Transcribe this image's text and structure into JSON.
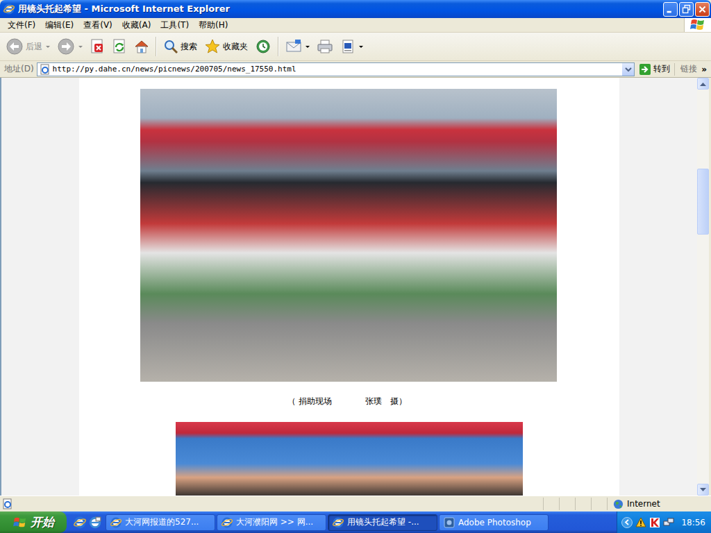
{
  "window": {
    "title": "用镜头托起希望 - Microsoft Internet Explorer"
  },
  "menu": [
    "文件(F)",
    "编辑(E)",
    "查看(V)",
    "收藏(A)",
    "工具(T)",
    "帮助(H)"
  ],
  "toolbar": [
    {
      "kind": "back",
      "label": "后退",
      "dropdown": true,
      "disabled": true
    },
    {
      "kind": "forward",
      "dropdown": true,
      "disabled": true
    },
    {
      "kind": "stop",
      "dropdown": false,
      "disabled": false
    },
    {
      "kind": "refresh",
      "dropdown": false,
      "disabled": false
    },
    {
      "kind": "home",
      "dropdown": false,
      "disabled": false
    },
    {
      "kind": "separator"
    },
    {
      "kind": "search",
      "label": "搜索",
      "dropdown": false,
      "disabled": false
    },
    {
      "kind": "favorites",
      "label": "收藏夹",
      "dropdown": false,
      "disabled": false
    },
    {
      "kind": "history",
      "dropdown": false,
      "disabled": false
    },
    {
      "kind": "separator"
    },
    {
      "kind": "mail",
      "dropdown": true,
      "disabled": false
    },
    {
      "kind": "print",
      "dropdown": false,
      "disabled": false
    },
    {
      "kind": "edit",
      "dropdown": true,
      "disabled": false
    }
  ],
  "address": {
    "label": "地址(D)",
    "url": "http://py.dahe.cn/news/picnews/200705/news_17550.html",
    "go": "转到",
    "links": "链接",
    "more": "»"
  },
  "page": {
    "caption": {
      "place": "（ 捐助现场",
      "author": "张璞",
      "credit": "摄）"
    }
  },
  "scrollbar": {
    "level": 0.24
  },
  "status_bar": {
    "zone": "Internet"
  },
  "taskbar": {
    "start": "开始",
    "tasks": [
      {
        "label": "大河网报道的527...",
        "kind": "ie",
        "selected": false
      },
      {
        "label": "大河濮阳网 >> 网...",
        "kind": "ie",
        "selected": false
      },
      {
        "label": "用镜头托起希望 -...",
        "kind": "ie",
        "selected": true
      },
      {
        "label": "Adobe Photoshop",
        "kind": "ps",
        "selected": false
      }
    ],
    "clock": "18:56"
  }
}
